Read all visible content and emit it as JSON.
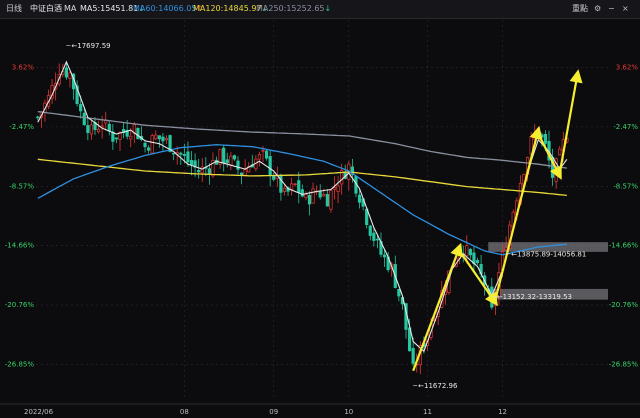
{
  "header": {
    "period": "日线",
    "index_name": "中证白酒",
    "ma_label": "MA",
    "ma5": {
      "label": "MA5:15451.81",
      "arrow": "↓",
      "color": "#e8e8e8"
    },
    "ma60": {
      "label": "MA60:14066.05",
      "arrow": "↑",
      "color": "#2f8fe0"
    },
    "ma120": {
      "label": "MA120:14845.97",
      "arrow": "↓",
      "color": "#e8d83a"
    },
    "ma250": {
      "label": "MA250:15252.65",
      "arrow": "↓",
      "color": "#8a8fa0"
    },
    "reset_label": "重點"
  },
  "colors": {
    "up": "#e53935",
    "down": "#26c6a0",
    "ma5": "#e8e8e8",
    "ma60": "#2f8fe0",
    "ma120": "#e8d83a",
    "ma250": "#8a8fa0",
    "arrow": "#f5ee30",
    "grid": "#2a2a32",
    "zone": "#9a9aa0"
  },
  "chart_data": {
    "type": "candlestick",
    "y_ticks": [
      {
        "label": "3.62%",
        "value": 3.62,
        "color": "#e53935"
      },
      {
        "label": "-2.47%",
        "value": -2.47,
        "color": "#3ad36a"
      },
      {
        "label": "-8.57%",
        "value": -8.57,
        "color": "#3ad36a"
      },
      {
        "label": "-14.66%",
        "value": -14.66,
        "color": "#3ad36a"
      },
      {
        "label": "-20.76%",
        "value": -20.76,
        "color": "#3ad36a"
      },
      {
        "label": "-26.85%",
        "value": -26.85,
        "color": "#3ad36a"
      }
    ],
    "ylim": [
      -30.5,
      8.5
    ],
    "x_ticks": [
      {
        "label": "2022/06",
        "index": 0
      },
      {
        "label": "08",
        "index": 41
      },
      {
        "label": "09",
        "index": 66
      },
      {
        "label": "10",
        "index": 87
      },
      {
        "label": "11",
        "index": 109
      },
      {
        "label": "12",
        "index": 130
      }
    ],
    "n_bars": 160,
    "annotations": [
      {
        "label": "17697.59",
        "index": 8,
        "value": 5.9
      },
      {
        "label": "11672.96",
        "index": 105,
        "value": -29.0
      },
      {
        "label": "13875.89-14056.81",
        "index": 131,
        "value": -15.5
      },
      {
        "label": "13152.32-13319.53",
        "index": 127,
        "value": -19.9
      }
    ],
    "zones": [
      {
        "label": "13875.89-14056.81",
        "from": -14.3,
        "to": -15.3
      },
      {
        "label": "13152.32-13319.53",
        "from": -19.1,
        "to": -20.2
      }
    ],
    "close_anchors": [
      [
        0,
        -1.5
      ],
      [
        3,
        0.5
      ],
      [
        6,
        3.5
      ],
      [
        9,
        3.0
      ],
      [
        12,
        -1.0
      ],
      [
        15,
        -3.0
      ],
      [
        18,
        -2.0
      ],
      [
        21,
        -3.5
      ],
      [
        24,
        -3.0
      ],
      [
        27,
        -2.5
      ],
      [
        30,
        -4.5
      ],
      [
        33,
        -3.5
      ],
      [
        36,
        -4.0
      ],
      [
        39,
        -5.0
      ],
      [
        42,
        -6.0
      ],
      [
        45,
        -7.0
      ],
      [
        48,
        -6.5
      ],
      [
        51,
        -5.5
      ],
      [
        54,
        -6.0
      ],
      [
        57,
        -7.2
      ],
      [
        60,
        -6.0
      ],
      [
        63,
        -5.5
      ],
      [
        66,
        -7.5
      ],
      [
        69,
        -9.5
      ],
      [
        72,
        -8.5
      ],
      [
        75,
        -10.0
      ],
      [
        78,
        -9.0
      ],
      [
        81,
        -9.8
      ],
      [
        84,
        -8.0
      ],
      [
        87,
        -6.5
      ],
      [
        90,
        -9.5
      ],
      [
        93,
        -13.0
      ],
      [
        96,
        -15.5
      ],
      [
        99,
        -17.0
      ],
      [
        102,
        -21.0
      ],
      [
        105,
        -27.5
      ],
      [
        108,
        -24.5
      ],
      [
        111,
        -21.5
      ],
      [
        114,
        -18.5
      ],
      [
        117,
        -15.5
      ],
      [
        119,
        -14.8
      ],
      [
        122,
        -16.5
      ],
      [
        125,
        -18.5
      ],
      [
        127,
        -21.5
      ],
      [
        129,
        -17.5
      ],
      [
        132,
        -12.5
      ],
      [
        135,
        -8.0
      ],
      [
        138,
        -4.0
      ],
      [
        140,
        -3.0
      ],
      [
        142,
        -4.5
      ],
      [
        144,
        -7.5
      ],
      [
        146,
        -5.5
      ],
      [
        148,
        -3.0
      ]
    ],
    "ma5_anchors": [
      [
        0,
        -2.0
      ],
      [
        4,
        0.8
      ],
      [
        8,
        4.2
      ],
      [
        10,
        2.5
      ],
      [
        14,
        -1.5
      ],
      [
        18,
        -2.6
      ],
      [
        22,
        -3.2
      ],
      [
        26,
        -2.8
      ],
      [
        30,
        -3.9
      ],
      [
        34,
        -4.2
      ],
      [
        38,
        -5.0
      ],
      [
        42,
        -6.3
      ],
      [
        46,
        -6.8
      ],
      [
        50,
        -6.0
      ],
      [
        54,
        -6.4
      ],
      [
        58,
        -6.8
      ],
      [
        62,
        -6.0
      ],
      [
        66,
        -7.0
      ],
      [
        70,
        -8.8
      ],
      [
        74,
        -9.4
      ],
      [
        78,
        -9.1
      ],
      [
        82,
        -8.9
      ],
      [
        87,
        -7.2
      ],
      [
        90,
        -8.8
      ],
      [
        94,
        -12.8
      ],
      [
        98,
        -15.8
      ],
      [
        102,
        -19.8
      ],
      [
        105,
        -24.5
      ],
      [
        108,
        -25.5
      ],
      [
        112,
        -21.5
      ],
      [
        116,
        -17.0
      ],
      [
        119,
        -15.5
      ],
      [
        123,
        -16.8
      ],
      [
        127,
        -19.8
      ],
      [
        130,
        -17.2
      ],
      [
        134,
        -11.5
      ],
      [
        138,
        -6.0
      ],
      [
        140,
        -3.8
      ],
      [
        143,
        -5.0
      ],
      [
        146,
        -6.8
      ],
      [
        148,
        -5.8
      ]
    ],
    "ma60_anchors": [
      [
        0,
        -9.8
      ],
      [
        10,
        -7.8
      ],
      [
        20,
        -6.5
      ],
      [
        30,
        -5.4
      ],
      [
        40,
        -4.6
      ],
      [
        50,
        -4.3
      ],
      [
        60,
        -4.5
      ],
      [
        70,
        -5.2
      ],
      [
        80,
        -6.0
      ],
      [
        87,
        -7.0
      ],
      [
        95,
        -9.0
      ],
      [
        105,
        -11.5
      ],
      [
        115,
        -13.5
      ],
      [
        125,
        -15.2
      ],
      [
        130,
        -15.6
      ],
      [
        135,
        -15.2
      ],
      [
        140,
        -14.8
      ],
      [
        148,
        -14.5
      ]
    ],
    "ma120_anchors": [
      [
        0,
        -5.8
      ],
      [
        15,
        -6.4
      ],
      [
        30,
        -7.0
      ],
      [
        45,
        -7.3
      ],
      [
        60,
        -7.5
      ],
      [
        75,
        -7.4
      ],
      [
        87,
        -7.1
      ],
      [
        100,
        -7.6
      ],
      [
        110,
        -8.1
      ],
      [
        120,
        -8.6
      ],
      [
        130,
        -8.9
      ],
      [
        140,
        -9.2
      ],
      [
        148,
        -9.5
      ]
    ],
    "ma250_anchors": [
      [
        0,
        -0.9
      ],
      [
        15,
        -1.6
      ],
      [
        30,
        -2.3
      ],
      [
        45,
        -2.7
      ],
      [
        60,
        -3.0
      ],
      [
        75,
        -3.2
      ],
      [
        87,
        -3.4
      ],
      [
        100,
        -4.2
      ],
      [
        110,
        -5.0
      ],
      [
        120,
        -5.6
      ],
      [
        130,
        -5.9
      ],
      [
        140,
        -6.3
      ],
      [
        148,
        -6.7
      ]
    ],
    "arrows": [
      {
        "from": [
          105,
          -27.5
        ],
        "to": [
          118,
          -14.8
        ]
      },
      {
        "from": [
          118,
          -15.2
        ],
        "to": [
          128,
          -20.5
        ]
      },
      {
        "from": [
          128,
          -20.2
        ],
        "to": [
          140,
          -2.8
        ]
      },
      {
        "from": [
          140,
          -3.2
        ],
        "to": [
          146,
          -7.5
        ]
      },
      {
        "from": [
          146,
          -7.2
        ],
        "to": [
          151,
          3.0
        ]
      }
    ]
  }
}
